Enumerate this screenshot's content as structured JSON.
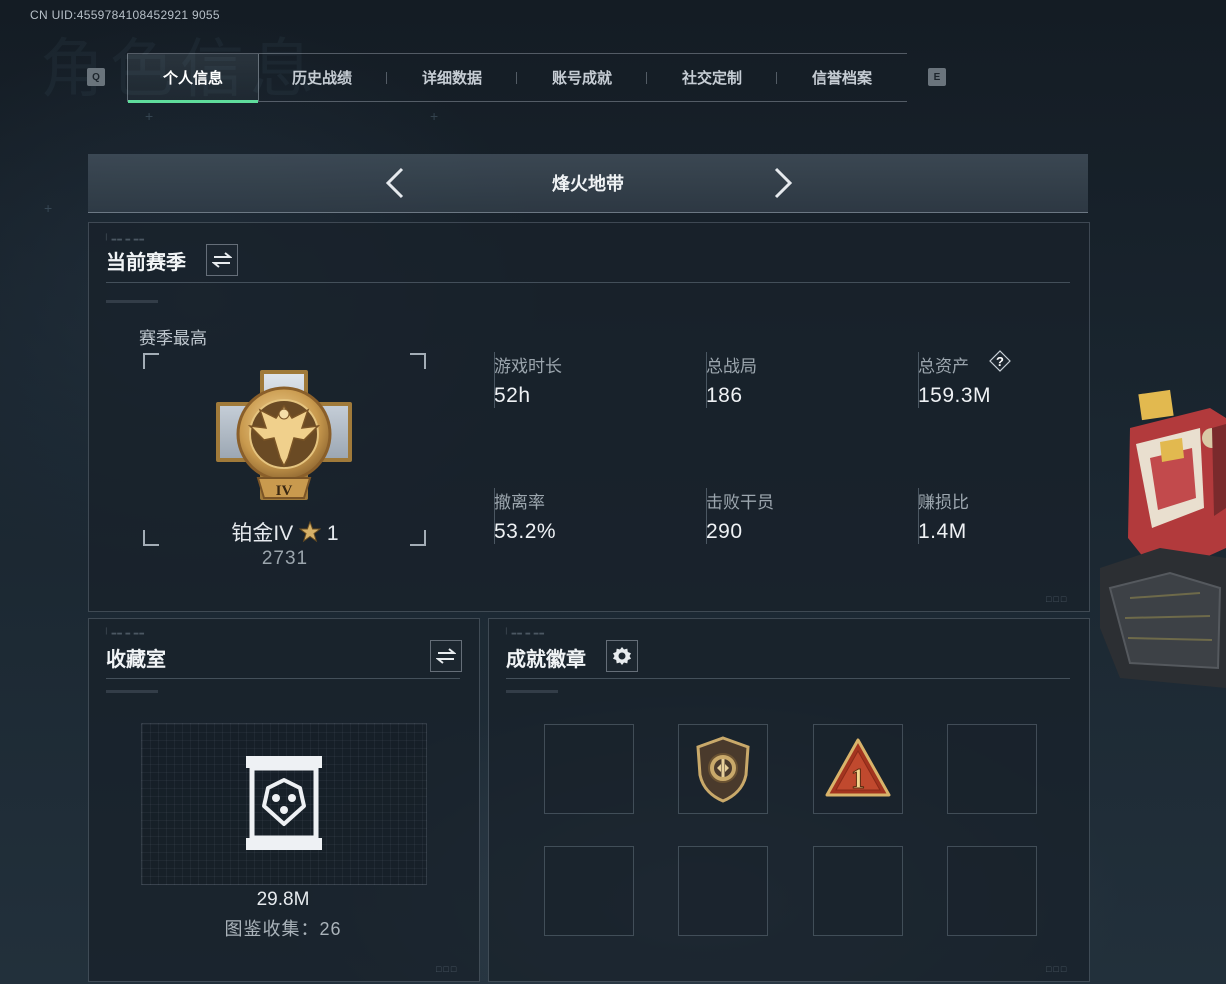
{
  "uid": "CN UID:4559784108452921 9055",
  "tabs": {
    "left_key": "Q",
    "right_key": "E",
    "items": [
      {
        "label": "个人信息",
        "active": true
      },
      {
        "label": "历史战绩"
      },
      {
        "label": "详细数据"
      },
      {
        "label": "账号成就"
      },
      {
        "label": "社交定制"
      },
      {
        "label": "信誉档案"
      }
    ]
  },
  "mode": {
    "title": "烽火地带"
  },
  "season": {
    "title": "当前赛季",
    "best_label": "赛季最高",
    "rank_name": "铂金IV",
    "rank_stars": "1",
    "rank_score": "2731",
    "rank_numeral": "IV",
    "stats": [
      {
        "label": "游戏时长",
        "value": "52h"
      },
      {
        "label": "总战局",
        "value": "186"
      },
      {
        "label": "总资产",
        "value": "159.3M",
        "has_help": true
      },
      {
        "label": "撤离率",
        "value": "53.2%"
      },
      {
        "label": "击败干员",
        "value": "290"
      },
      {
        "label": "赚损比",
        "value": "1.4M"
      }
    ]
  },
  "collection": {
    "title": "收藏室",
    "value": "29.8M",
    "count_text": "图鉴收集：26"
  },
  "badges": {
    "title": "成就徽章",
    "slots": [
      {
        "badge": null
      },
      {
        "badge": "shield-emblem"
      },
      {
        "badge": "triangle-number-one",
        "text": "1"
      },
      {
        "badge": null
      },
      {
        "badge": null
      },
      {
        "badge": null
      },
      {
        "badge": null
      },
      {
        "badge": null
      }
    ]
  },
  "colors": {
    "accent": "#5fdc9c",
    "gold": "#c9a050",
    "badge_red": "#a3341f"
  }
}
